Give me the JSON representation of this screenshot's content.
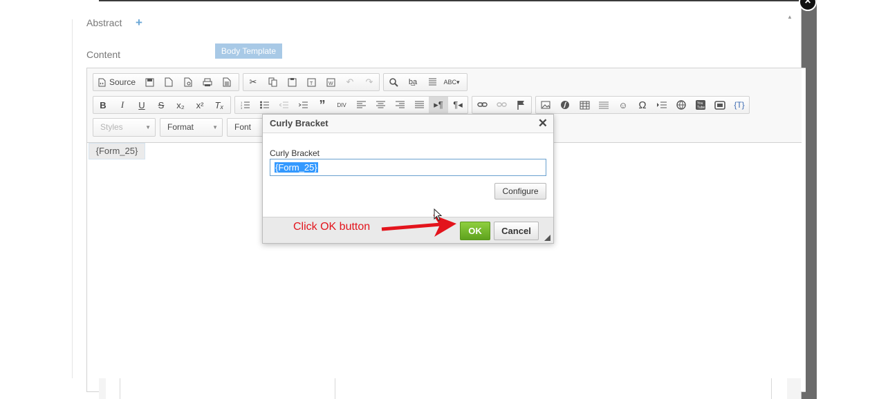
{
  "fields": {
    "abstract_label": "Abstract",
    "content_label": "Content",
    "body_template_button": "Body Template"
  },
  "toolbar": {
    "source_label": "Source",
    "styles_combo": "Styles",
    "format_combo": "Format",
    "font_combo": "Font",
    "curly_bracket_button": "{T}"
  },
  "editor": {
    "content_token": "{Form_25}"
  },
  "dialog": {
    "title": "Curly Bracket",
    "field_label": "Curly Bracket",
    "field_value": "{Form_25}",
    "configure_button": "Configure",
    "ok_button": "OK",
    "cancel_button": "Cancel"
  },
  "annotation": {
    "text": "Click OK button",
    "color": "#e3141c"
  },
  "colors": {
    "ok_green": "#6cb52a",
    "tag_blue": "#a8c9e6",
    "plus_blue": "#6aa7d6"
  }
}
